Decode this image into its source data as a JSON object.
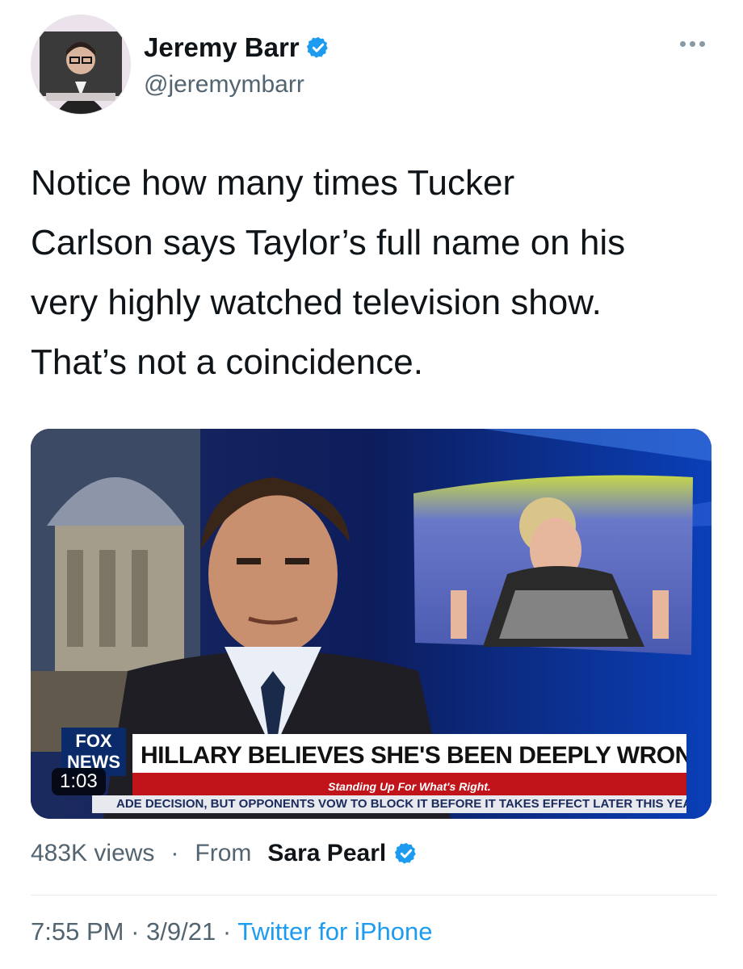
{
  "author": {
    "name": "Jeremy Barr",
    "handle": "@jeremymbarr",
    "verified": true,
    "more_icon": "more-horizontal-icon"
  },
  "tweet": {
    "text": "Notice how many times Tucker\nCarlson says Taylor’s full name on his\nvery highly watched television show.\nThat’s not a coincidence."
  },
  "video": {
    "duration": "1:03",
    "logo_line1": "FOX",
    "logo_line2": "NEWS",
    "chyron": "HILLARY BELIEVES SHE'S BEEN DEEPLY WRONGED",
    "tagline": "Standing Up For What's Right.",
    "ticker": "ADE DECISION, BUT OPPONENTS VOW TO BLOCK IT BEFORE IT TAKES EFFECT LATER THIS YEAR..."
  },
  "stats": {
    "views": "483K views",
    "separator": "·",
    "from_label": "From",
    "from_name": "Sara Pearl"
  },
  "footer": {
    "time": "7:55 PM",
    "date": "3/9/21",
    "separator": "·",
    "source": "Twitter for iPhone"
  },
  "colors": {
    "verified_blue": "#1d9bf0",
    "secondary_text": "#536471",
    "fox_red": "#c0141a"
  }
}
